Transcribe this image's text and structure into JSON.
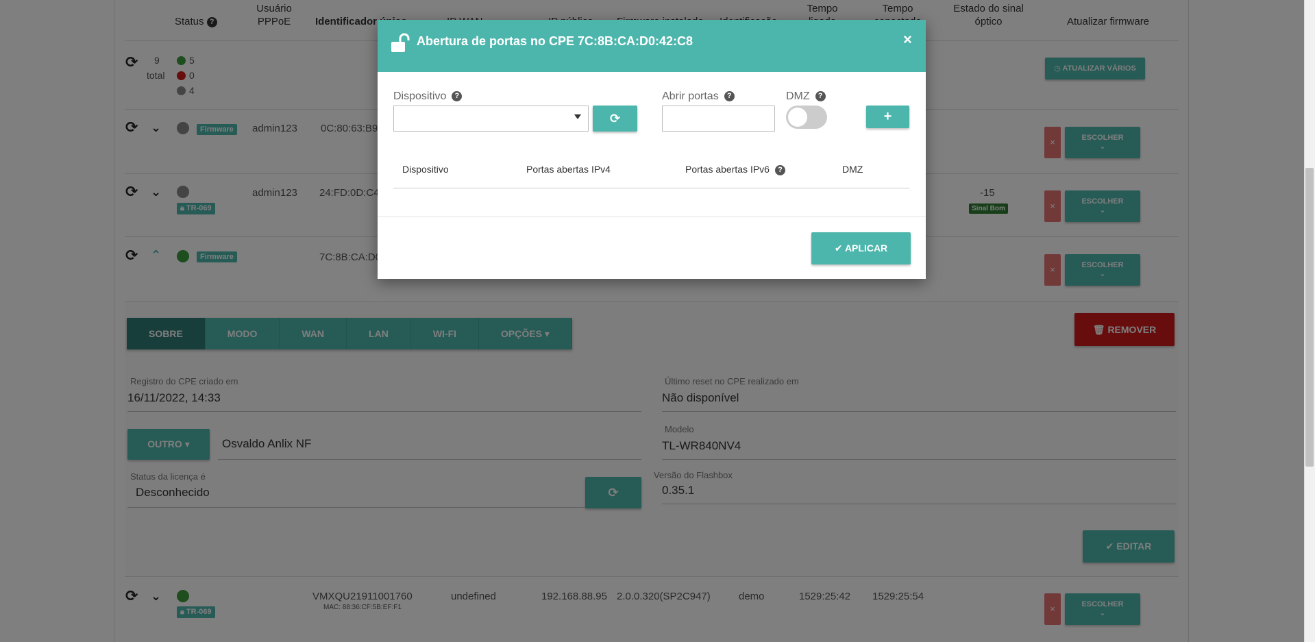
{
  "table": {
    "headers": {
      "status": "Status",
      "usuario": "Usuário",
      "pppoe": "PPPoE",
      "identificador": "Identificador único",
      "ipwan": "IP WAN",
      "ippublico": "IP público",
      "firmware": "Firmware instalado",
      "identificacao": "Identificação",
      "tempo_ligado_1": "Tempo",
      "tempo_ligado_2": "ligado",
      "tempo_conectado_1": "Tempo",
      "tempo_conectado_2": "conectado",
      "sinal_1": "Estado do sinal",
      "sinal_2": "óptico",
      "atualizar": "Atualizar firmware"
    },
    "summary": {
      "total_count": "9",
      "total_label": "total",
      "online": "5",
      "offline": "0",
      "unknown": "4",
      "update_many": "ATUALIZAR VÁRIOS"
    },
    "rows": [
      {
        "badge": "Firmware",
        "user": "admin123",
        "id": "0C:80:63:B9:6",
        "status": "grey",
        "action": "ESCOLHER"
      },
      {
        "badge": "TR-069",
        "user": "admin123",
        "id": "24:FD:0D:C4:5",
        "status": "grey",
        "signal": "-15",
        "signal_badge": "Sinal Bom",
        "action": "ESCOLHER"
      },
      {
        "badge": "Firmware",
        "user": "",
        "id": "7C:8B:CA:D0:4",
        "status": "green",
        "action": "ESCOLHER"
      },
      {
        "badge": "TR-069",
        "user": "",
        "id": "VMXQU21911001760",
        "mac": "MAC: 88:36:CF:5B:EF:F1",
        "wan": "undefined",
        "ip": "192.168.88.95",
        "fw": "2.0.0.320(SP2C947)",
        "ident": "demo",
        "uptime": "1529:25:42",
        "conntime": "1529:25:54",
        "status": "green",
        "action": "ESCOLHER"
      }
    ]
  },
  "detail": {
    "tabs": [
      "SOBRE",
      "MODO",
      "WAN",
      "LAN",
      "WI-FI",
      "OPÇÕES"
    ],
    "remove": "REMOVER",
    "created_label": "Registro do CPE criado em",
    "created_value": "16/11/2022, 14:33",
    "reset_label": "Último reset no CPE realizado em",
    "reset_value": "Não disponível",
    "outro": "OUTRO",
    "vendor": "Osvaldo Anlix NF",
    "model_label": "Modelo",
    "model_value": "TL-WR840NV4",
    "license_label": "Status da licença é",
    "license_value": "Desconhecido",
    "flashbox_label": "Versão do Flashbox",
    "flashbox_value": "0.35.1",
    "edit": "EDITAR"
  },
  "modal": {
    "title": "Abertura de portas no CPE  7C:8B:CA:D0:42:C8",
    "close": "×",
    "device_label": "Dispositivo",
    "ports_label": "Abrir portas",
    "dmz_label": "DMZ",
    "add": "+",
    "col_device": "Dispositivo",
    "col_ipv4": "Portas abertas IPv4",
    "col_ipv6": "Portas abertas IPv6",
    "col_dmz": "DMZ",
    "apply": "APLICAR"
  },
  "colors": {
    "teal": "#4db6ac",
    "teal_dark": "#2f7d76",
    "red": "#d01b1b"
  },
  "icons": [
    "sync-icon",
    "chevron-down-icon",
    "chevron-up-icon",
    "lock-icon",
    "clock-icon",
    "trash-icon",
    "check-icon",
    "unlock-icon",
    "question-icon",
    "refresh-icon",
    "close-icon"
  ]
}
